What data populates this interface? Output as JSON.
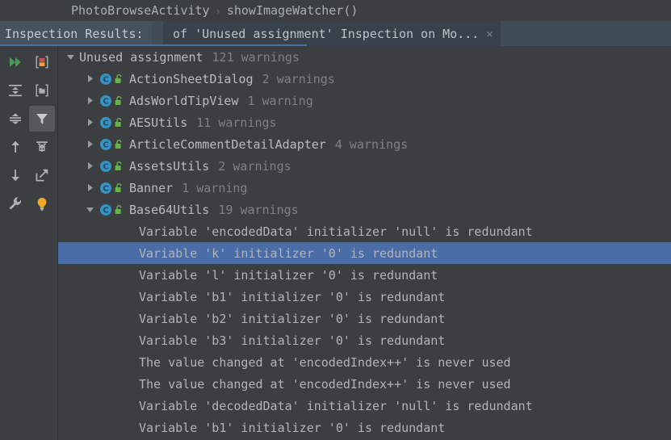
{
  "window": {
    "background": "#3c3f41",
    "accent": "#4a6da7"
  },
  "breadcrumb": {
    "items": [
      "PhotoBrowseActivity",
      "showImageWatcher()"
    ],
    "separator": "›"
  },
  "tab_bar": {
    "results_label": "Inspection Results:",
    "tab_title": "of 'Unused assignment' Inspection on Mo...",
    "close_label": "×"
  },
  "toolbar": {
    "left_column": [
      {
        "name": "rerun-inspection-icon",
        "label": "Rerun inspection",
        "active": false
      },
      {
        "name": "expand-all-icon",
        "label": "Expand All",
        "active": false
      },
      {
        "name": "collapse-all-icon",
        "label": "Collapse All",
        "active": false
      },
      {
        "name": "previous-occurrence-icon",
        "label": "Previous Occurrence",
        "active": false
      },
      {
        "name": "next-occurrence-icon",
        "label": "Next Occurrence",
        "active": false
      },
      {
        "name": "settings-wrench-icon",
        "label": "Inspection Settings",
        "active": false
      }
    ],
    "right_column": [
      {
        "name": "group-by-severity-icon",
        "label": "Group by Severity",
        "active": false
      },
      {
        "name": "group-by-directory-icon",
        "label": "Group by Directory",
        "active": false
      },
      {
        "name": "filter-icon",
        "label": "Filter Inspections",
        "active": true
      },
      {
        "name": "export-to-editor-icon",
        "label": "Open in Editor",
        "active": false
      },
      {
        "name": "export-icon",
        "label": "Export",
        "active": false
      },
      {
        "name": "quick-fix-bulb-icon",
        "label": "Apply Quick Fix",
        "active": false
      }
    ],
    "colors": {
      "icon": "#afb1b3",
      "run_green": "#499c54",
      "bulb_yellow": "#f4a725",
      "severity_red": "#c75450",
      "severity_orange": "#e8a33d",
      "active_bg": "#55595c"
    }
  },
  "tree": {
    "colors": {
      "class_icon": "#3592c4",
      "lock_green": "#62b543",
      "label": "#bbbbbb",
      "count": "#808080",
      "selection": "#4a6da7"
    },
    "rows": [
      {
        "level": 0,
        "state": "expanded",
        "icons": [],
        "label": "Unused assignment",
        "count": "121 warnings",
        "selected": false
      },
      {
        "level": 1,
        "state": "collapsed",
        "icons": [
          "class",
          "lock"
        ],
        "label": "ActionSheetDialog",
        "count": "2 warnings",
        "selected": false
      },
      {
        "level": 1,
        "state": "collapsed",
        "icons": [
          "class",
          "lock"
        ],
        "label": "AdsWorldTipView",
        "count": "1 warning",
        "selected": false
      },
      {
        "level": 1,
        "state": "collapsed",
        "icons": [
          "class",
          "lock"
        ],
        "label": "AESUtils",
        "count": "11 warnings",
        "selected": false
      },
      {
        "level": 1,
        "state": "collapsed",
        "icons": [
          "class",
          "lock"
        ],
        "label": "ArticleCommentDetailAdapter",
        "count": "4 warnings",
        "selected": false
      },
      {
        "level": 1,
        "state": "collapsed",
        "icons": [
          "class",
          "lock"
        ],
        "label": "AssetsUtils",
        "count": "2 warnings",
        "selected": false
      },
      {
        "level": 1,
        "state": "collapsed",
        "icons": [
          "class",
          "lock"
        ],
        "label": "Banner",
        "count": "1 warning",
        "selected": false
      },
      {
        "level": 1,
        "state": "expanded",
        "icons": [
          "class",
          "lock"
        ],
        "label": "Base64Utils",
        "count": "19 warnings",
        "selected": false
      },
      {
        "level": 2,
        "state": "leaf",
        "icons": [],
        "label": "Variable 'encodedData' initializer 'null' is redundant",
        "count": "",
        "selected": false
      },
      {
        "level": 2,
        "state": "leaf",
        "icons": [],
        "label": "Variable 'k' initializer '0' is redundant",
        "count": "",
        "selected": true
      },
      {
        "level": 2,
        "state": "leaf",
        "icons": [],
        "label": "Variable 'l' initializer '0' is redundant",
        "count": "",
        "selected": false
      },
      {
        "level": 2,
        "state": "leaf",
        "icons": [],
        "label": "Variable 'b1' initializer '0' is redundant",
        "count": "",
        "selected": false
      },
      {
        "level": 2,
        "state": "leaf",
        "icons": [],
        "label": "Variable 'b2' initializer '0' is redundant",
        "count": "",
        "selected": false
      },
      {
        "level": 2,
        "state": "leaf",
        "icons": [],
        "label": "Variable 'b3' initializer '0' is redundant",
        "count": "",
        "selected": false
      },
      {
        "level": 2,
        "state": "leaf",
        "icons": [],
        "label": "The value changed at 'encodedIndex++' is never used",
        "count": "",
        "selected": false
      },
      {
        "level": 2,
        "state": "leaf",
        "icons": [],
        "label": "The value changed at 'encodedIndex++' is never used",
        "count": "",
        "selected": false
      },
      {
        "level": 2,
        "state": "leaf",
        "icons": [],
        "label": "Variable 'decodedData' initializer 'null' is redundant",
        "count": "",
        "selected": false
      },
      {
        "level": 2,
        "state": "leaf",
        "icons": [],
        "label": "Variable 'b1' initializer '0' is redundant",
        "count": "",
        "selected": false
      }
    ]
  }
}
